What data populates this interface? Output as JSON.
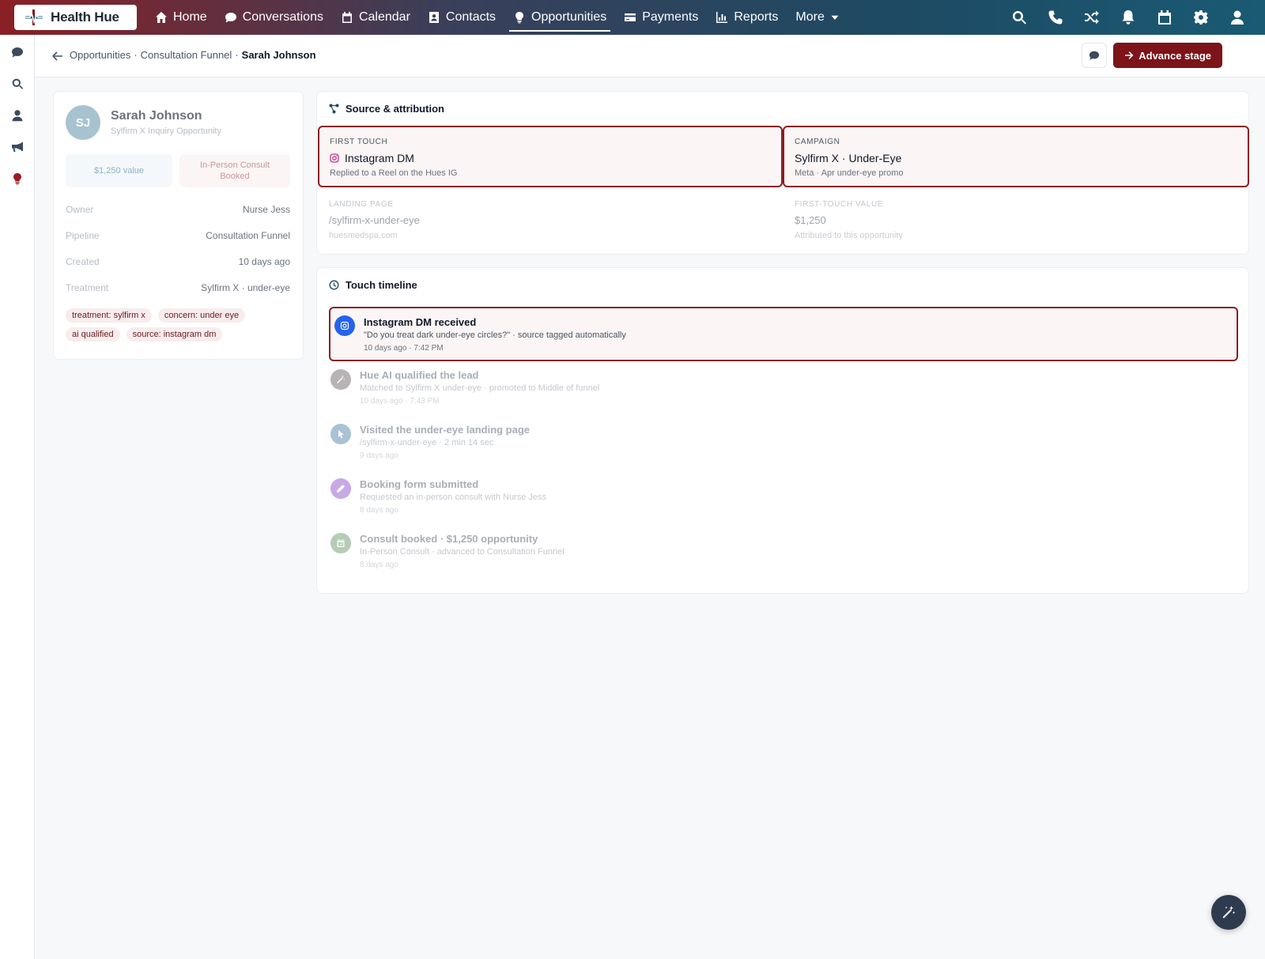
{
  "brand": {
    "name": "Health Hue"
  },
  "nav": {
    "items": [
      {
        "label": "Home",
        "icon": "home-icon"
      },
      {
        "label": "Conversations",
        "icon": "chat-icon"
      },
      {
        "label": "Calendar",
        "icon": "calendar-icon"
      },
      {
        "label": "Contacts",
        "icon": "contact-card-icon"
      },
      {
        "label": "Opportunities",
        "icon": "lightbulb-icon",
        "active": true
      },
      {
        "label": "Payments",
        "icon": "credit-card-icon"
      },
      {
        "label": "Reports",
        "icon": "bar-chart-icon"
      },
      {
        "label": "More",
        "icon": "chevron-down-icon"
      }
    ],
    "right_icons": [
      "search-icon",
      "phone-icon",
      "shuffle-icon",
      "bell-icon",
      "calendar-icon",
      "gear-icon",
      "user-icon"
    ]
  },
  "rail": {
    "icons": [
      "chat-icon",
      "search-icon",
      "user-icon",
      "megaphone-icon",
      "lightbulb-icon"
    ]
  },
  "breadcrumb": {
    "items": [
      "Opportunities",
      "·",
      "Consultation Funnel",
      "·"
    ],
    "current": "Sarah Johnson"
  },
  "header": {
    "advance_label": "Advance stage"
  },
  "profile": {
    "initials": "SJ",
    "name": "Sarah Johnson",
    "subtitle": "Sylfirm X Inquiry Opportunity",
    "value_pill": "$1,250 value",
    "stage_pill_line1": "In-Person Consult",
    "stage_pill_line2": "Booked",
    "fields": [
      {
        "key": "Owner",
        "value": "Nurse Jess"
      },
      {
        "key": "Pipeline",
        "value": "Consultation Funnel"
      },
      {
        "key": "Created",
        "value": "10 days ago"
      },
      {
        "key": "Treatment",
        "value": "Sylfirm X · under-eye"
      }
    ],
    "tags": [
      "treatment: sylfirm x",
      "concern: under eye",
      "ai qualified",
      "source: instagram dm"
    ]
  },
  "source": {
    "title": "Source & attribution",
    "first_touch": {
      "label": "FIRST TOUCH",
      "value": "Instagram DM",
      "note": "Replied to a Reel on the Hues IG"
    },
    "campaign": {
      "label": "CAMPAIGN",
      "value": "Sylfirm X · Under-Eye",
      "note": "Meta · Apr under-eye promo"
    },
    "landing": {
      "label": "LANDING PAGE",
      "value": "/sylfirm-x-under-eye",
      "note": "huesmedspa.com"
    },
    "ft_value": {
      "label": "FIRST-TOUCH VALUE",
      "value": "$1,250",
      "note": "Attributed to this opportunity"
    }
  },
  "timeline": {
    "title": "Touch timeline",
    "items": [
      {
        "title": "Instagram DM received",
        "desc": "\"Do you treat dark under-eye circles?\" · source tagged automatically",
        "time": "10 days ago · 7:42 PM",
        "color": "#2563eb",
        "icon": "instagram-icon"
      },
      {
        "title": "Hue AI qualified the lead",
        "desc": "Matched to Sylfirm X under-eye · promoted to Middle of funnel",
        "time": "10 days ago · 7:43 PM",
        "color": "#b9b3b6",
        "icon": "magic-wand-icon"
      },
      {
        "title": "Visited the under-eye landing page",
        "desc": "/sylfirm-x-under-eye · 2 min 14 sec",
        "time": "9 days ago",
        "color": "#a7c3d4",
        "icon": "cursor-icon"
      },
      {
        "title": "Booking form submitted",
        "desc": "Requested an in-person consult with Nurse Jess",
        "time": "8 days ago",
        "color": "#c6a9e6",
        "icon": "pencil-icon"
      },
      {
        "title": "Consult booked · $1,250 opportunity",
        "desc": "In-Person Consult · advanced to Consultation Funnel",
        "time": "8 days ago",
        "color": "#b5ccb5",
        "icon": "calendar-check-icon"
      }
    ]
  },
  "colors": {
    "accent": "#7c1419",
    "highlight_border": "#8a1f24",
    "highlight_bg": "#fbf5f5"
  }
}
